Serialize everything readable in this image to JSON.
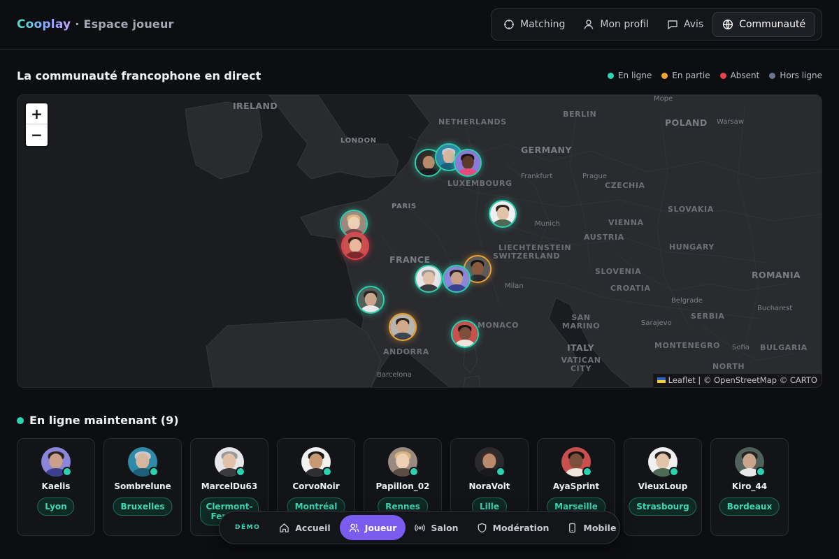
{
  "brand": {
    "logo": "Cooplay",
    "subtitle": "· Espace joueur"
  },
  "nav": {
    "items": [
      {
        "label": "Matching",
        "icon": "crosshair-icon"
      },
      {
        "label": "Mon profil",
        "icon": "user-icon"
      },
      {
        "label": "Avis",
        "icon": "message-icon"
      },
      {
        "label": "Communauté",
        "icon": "globe-icon",
        "active": true
      }
    ]
  },
  "section": {
    "title": "La communauté francophone en direct"
  },
  "legend": [
    {
      "label": "En ligne",
      "color": "#2bd3b0"
    },
    {
      "label": "En partie",
      "color": "#f0a434"
    },
    {
      "label": "Absent",
      "color": "#e8424d"
    },
    {
      "label": "Hors ligne",
      "color": "#6b7490"
    }
  ],
  "map": {
    "zoom_in": "+",
    "zoom_out": "−",
    "attribution": "Leaflet | © OpenStreetMap © CARTO",
    "labels": {
      "ireland": "IRELAND",
      "london": "LONDON",
      "netherlands": "NETHERLANDS",
      "berlin": "BERLIN",
      "poland": "POLAND",
      "warsaw": "Warsaw",
      "germany": "GERMANY",
      "frankfurt": "Frankfurt",
      "prague": "Prague",
      "czechia": "CZECHIA",
      "luxembourg": "LUXEMBOURG",
      "paris": "PARIS",
      "slovakia": "SLOVAKIA",
      "munich": "Munich",
      "vienna": "VIENNA",
      "austria": "AUSTRIA",
      "liechtenstein": "LIECHTENSTEIN",
      "switzerland": "SWITZERLAND",
      "hungary": "HUNGARY",
      "france": "FRANCE",
      "slovenia": "SLOVENIA",
      "romania": "ROMANIA",
      "milan": "Milan",
      "croatia": "CROATIA",
      "belgrade": "Belgrade",
      "bucharest": "Bucharest",
      "monaco": "MONACO",
      "san_marino": "SAN MARINO",
      "serbia": "SERBIA",
      "sarajevo": "Sarajevo",
      "montenegro": "MONTENEGRO",
      "sofia": "Sofia",
      "bulgaria": "BULGARIA",
      "andorra": "ANDORRA",
      "italy": "ITALY",
      "vatican": "VATICAN CITY",
      "north": "NORTH",
      "barcelona": "Barcelona",
      "mope": "Mope"
    }
  },
  "online": {
    "title": "En ligne maintenant (9)",
    "players": [
      {
        "name": "Kaelis",
        "city": "Lyon",
        "skin": "#c9a08a",
        "bg": "#8b86d9",
        "hair": "#2c2420",
        "top": "#3b3f8f"
      },
      {
        "name": "Sombrelune",
        "city": "Bruxelles",
        "skin": "#d7b6a0",
        "bg": "#2f8aa8",
        "hair": "#c9c9cf",
        "top": "#1d5f7a"
      },
      {
        "name": "MarcelDu63",
        "city": "Clermont-Ferrand",
        "skin": "#e2c1a9",
        "bg": "#e7e7ea",
        "hair": "#9a9a9a",
        "top": "#3a3a3f"
      },
      {
        "name": "CorvoNoir",
        "city": "Montréal",
        "skin": "#c79a74",
        "bg": "#f2f2f2",
        "hair": "#1e1a18",
        "top": "#2e2e33"
      },
      {
        "name": "Papillon_02",
        "city": "Rennes",
        "skin": "#edd0b6",
        "bg": "#9a8a80",
        "hair": "#d9b57a",
        "top": "#5a4d45"
      },
      {
        "name": "NoraVolt",
        "city": "Lille",
        "skin": "#b98b6a",
        "bg": "#2b2a2d",
        "hair": "#3b2a22",
        "top": "#1a1a1c"
      },
      {
        "name": "AyaSprint",
        "city": "Marseille",
        "skin": "#7d4f3a",
        "bg": "#c9504e",
        "hair": "#1a1412",
        "top": "#f0e5dc"
      },
      {
        "name": "VieuxLoup",
        "city": "Strasbourg",
        "skin": "#e0c3a8",
        "bg": "#f0f0f0",
        "hair": "#2a2422",
        "top": "#4c6b55"
      },
      {
        "name": "Kiro_44",
        "city": "Bordeaux",
        "skin": "#caa58c",
        "bg": "#50605a",
        "hair": "#242424",
        "top": "#e8e8e8"
      }
    ]
  },
  "demobar": {
    "label": "DÉMO",
    "items": [
      {
        "label": "Accueil",
        "icon": "home-icon"
      },
      {
        "label": "Joueur",
        "icon": "users-icon",
        "active": true
      },
      {
        "label": "Salon",
        "icon": "broadcast-icon"
      },
      {
        "label": "Modération",
        "icon": "shield-icon"
      },
      {
        "label": "Mobile",
        "icon": "phone-icon"
      }
    ]
  }
}
